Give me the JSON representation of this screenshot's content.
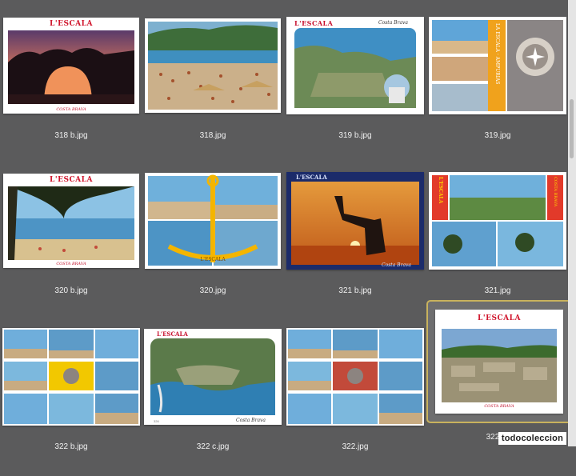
{
  "files": [
    {
      "name": "318 b.jpg"
    },
    {
      "name": "318.jpg"
    },
    {
      "name": "319 b.jpg"
    },
    {
      "name": "319.jpg"
    },
    {
      "name": "320 b.jpg"
    },
    {
      "name": "320.jpg"
    },
    {
      "name": "321 b.jpg"
    },
    {
      "name": "321.jpg"
    },
    {
      "name": "322 b.jpg"
    },
    {
      "name": "322 c.jpg"
    },
    {
      "name": "322.jpg"
    },
    {
      "name": "322.jpg"
    }
  ],
  "postcard": {
    "brand": "L'ESCALA",
    "costa_brava": "COSTA BRAVA",
    "costa_brava_script": "Costa Brava",
    "vertical_left": "L'ESCALA",
    "vertical_right": "COSTA BRAVA",
    "empuries": "LA ESCALA · AMPURIAS",
    "anchor_text": "L'ESCALA",
    "code_322c": "326"
  },
  "watermark": "todocoleccion",
  "selected_index": 11
}
